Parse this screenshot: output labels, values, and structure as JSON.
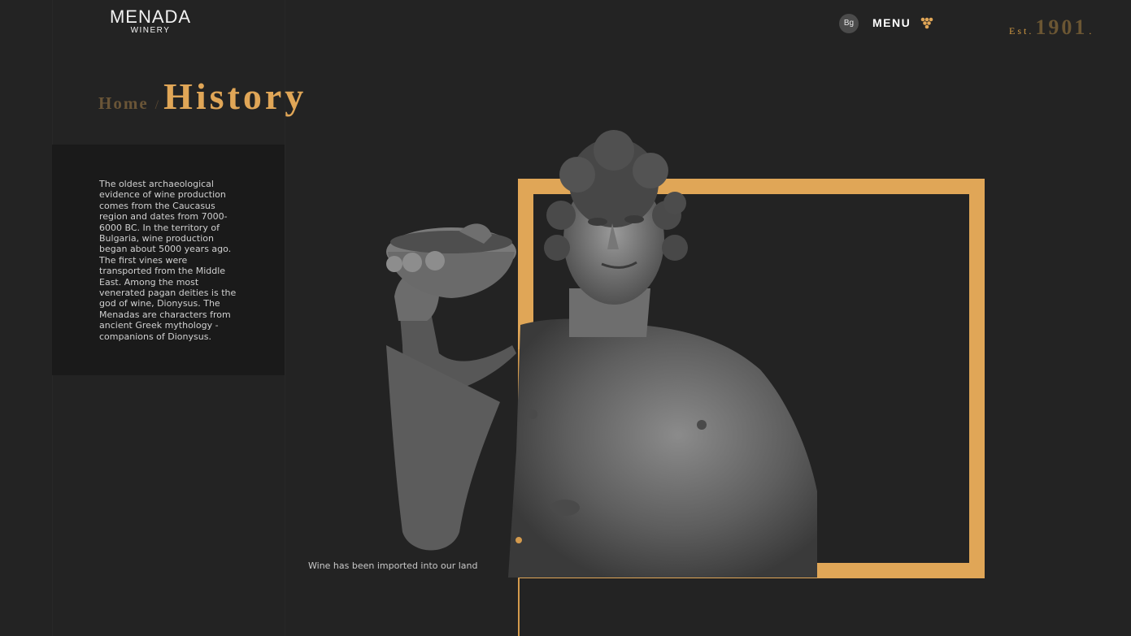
{
  "brand": {
    "name": "MENADA",
    "subtitle": "WINERY"
  },
  "header": {
    "lang_label": "Bg",
    "menu_label": "MENU",
    "menu_icon": "grape-icon",
    "est_label": "Est.",
    "est_year": "1901",
    "est_dot": "."
  },
  "breadcrumb": {
    "home": "Home",
    "separator": "/",
    "current": "History"
  },
  "intro": {
    "text": "The oldest archaeological evidence of wine production comes from the Caucasus region and dates from 7000-6000 BC. In the territory of Bulgaria, wine production began about 5000 years ago. The first vines were transported from the Middle East. Among the most venerated pagan deities is the god of wine, Dionysus. The Menadas are characters from ancient Greek mythology - companions of Dionysus."
  },
  "timeline": {
    "caption": "Wine has been imported into our land"
  },
  "colors": {
    "background": "#232323",
    "accent": "#e0a657",
    "panel": "#1a1a1a"
  }
}
